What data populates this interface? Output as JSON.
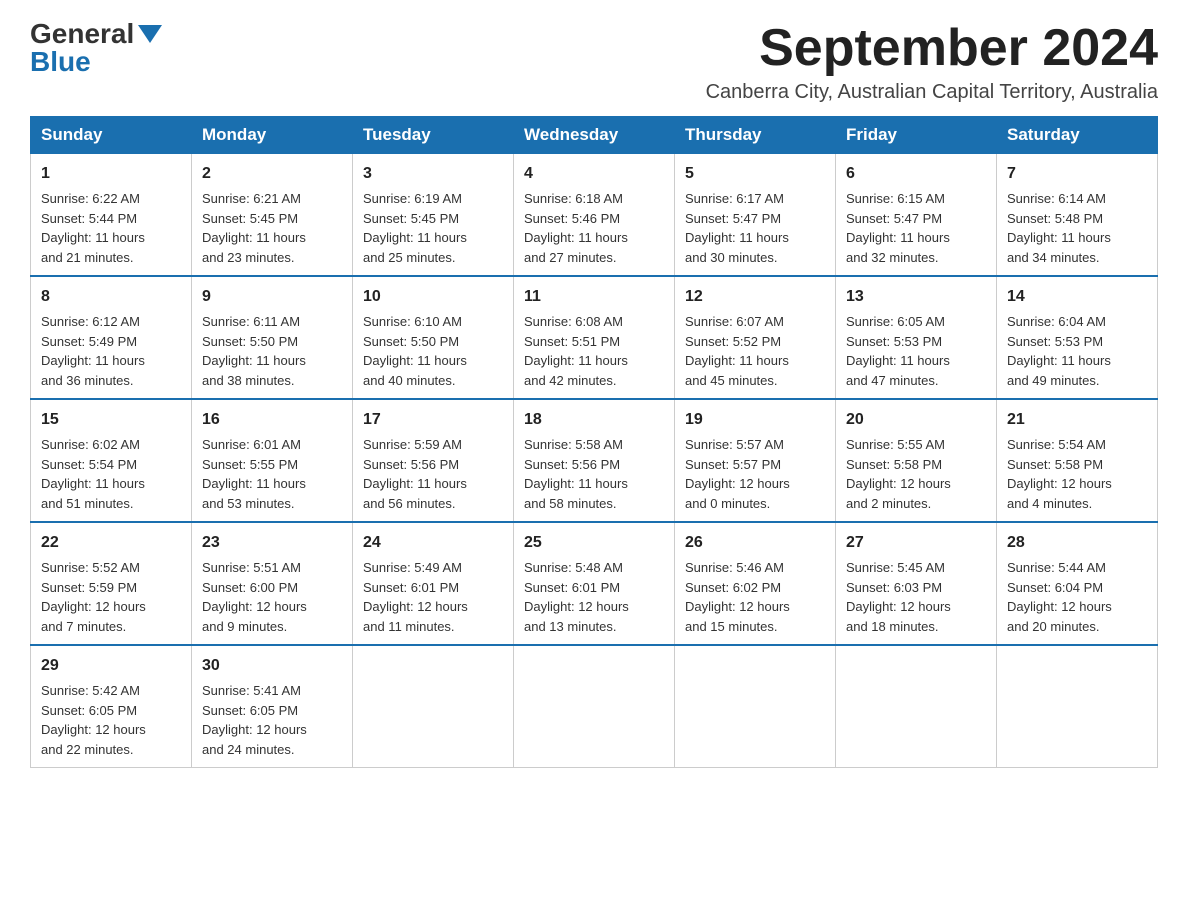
{
  "logo": {
    "general": "General",
    "blue": "Blue"
  },
  "title": "September 2024",
  "subtitle": "Canberra City, Australian Capital Territory, Australia",
  "days_of_week": [
    "Sunday",
    "Monday",
    "Tuesday",
    "Wednesday",
    "Thursday",
    "Friday",
    "Saturday"
  ],
  "weeks": [
    [
      {
        "day": "1",
        "sunrise": "6:22 AM",
        "sunset": "5:44 PM",
        "daylight": "11 hours and 21 minutes."
      },
      {
        "day": "2",
        "sunrise": "6:21 AM",
        "sunset": "5:45 PM",
        "daylight": "11 hours and 23 minutes."
      },
      {
        "day": "3",
        "sunrise": "6:19 AM",
        "sunset": "5:45 PM",
        "daylight": "11 hours and 25 minutes."
      },
      {
        "day": "4",
        "sunrise": "6:18 AM",
        "sunset": "5:46 PM",
        "daylight": "11 hours and 27 minutes."
      },
      {
        "day": "5",
        "sunrise": "6:17 AM",
        "sunset": "5:47 PM",
        "daylight": "11 hours and 30 minutes."
      },
      {
        "day": "6",
        "sunrise": "6:15 AM",
        "sunset": "5:47 PM",
        "daylight": "11 hours and 32 minutes."
      },
      {
        "day": "7",
        "sunrise": "6:14 AM",
        "sunset": "5:48 PM",
        "daylight": "11 hours and 34 minutes."
      }
    ],
    [
      {
        "day": "8",
        "sunrise": "6:12 AM",
        "sunset": "5:49 PM",
        "daylight": "11 hours and 36 minutes."
      },
      {
        "day": "9",
        "sunrise": "6:11 AM",
        "sunset": "5:50 PM",
        "daylight": "11 hours and 38 minutes."
      },
      {
        "day": "10",
        "sunrise": "6:10 AM",
        "sunset": "5:50 PM",
        "daylight": "11 hours and 40 minutes."
      },
      {
        "day": "11",
        "sunrise": "6:08 AM",
        "sunset": "5:51 PM",
        "daylight": "11 hours and 42 minutes."
      },
      {
        "day": "12",
        "sunrise": "6:07 AM",
        "sunset": "5:52 PM",
        "daylight": "11 hours and 45 minutes."
      },
      {
        "day": "13",
        "sunrise": "6:05 AM",
        "sunset": "5:53 PM",
        "daylight": "11 hours and 47 minutes."
      },
      {
        "day": "14",
        "sunrise": "6:04 AM",
        "sunset": "5:53 PM",
        "daylight": "11 hours and 49 minutes."
      }
    ],
    [
      {
        "day": "15",
        "sunrise": "6:02 AM",
        "sunset": "5:54 PM",
        "daylight": "11 hours and 51 minutes."
      },
      {
        "day": "16",
        "sunrise": "6:01 AM",
        "sunset": "5:55 PM",
        "daylight": "11 hours and 53 minutes."
      },
      {
        "day": "17",
        "sunrise": "5:59 AM",
        "sunset": "5:56 PM",
        "daylight": "11 hours and 56 minutes."
      },
      {
        "day": "18",
        "sunrise": "5:58 AM",
        "sunset": "5:56 PM",
        "daylight": "11 hours and 58 minutes."
      },
      {
        "day": "19",
        "sunrise": "5:57 AM",
        "sunset": "5:57 PM",
        "daylight": "12 hours and 0 minutes."
      },
      {
        "day": "20",
        "sunrise": "5:55 AM",
        "sunset": "5:58 PM",
        "daylight": "12 hours and 2 minutes."
      },
      {
        "day": "21",
        "sunrise": "5:54 AM",
        "sunset": "5:58 PM",
        "daylight": "12 hours and 4 minutes."
      }
    ],
    [
      {
        "day": "22",
        "sunrise": "5:52 AM",
        "sunset": "5:59 PM",
        "daylight": "12 hours and 7 minutes."
      },
      {
        "day": "23",
        "sunrise": "5:51 AM",
        "sunset": "6:00 PM",
        "daylight": "12 hours and 9 minutes."
      },
      {
        "day": "24",
        "sunrise": "5:49 AM",
        "sunset": "6:01 PM",
        "daylight": "12 hours and 11 minutes."
      },
      {
        "day": "25",
        "sunrise": "5:48 AM",
        "sunset": "6:01 PM",
        "daylight": "12 hours and 13 minutes."
      },
      {
        "day": "26",
        "sunrise": "5:46 AM",
        "sunset": "6:02 PM",
        "daylight": "12 hours and 15 minutes."
      },
      {
        "day": "27",
        "sunrise": "5:45 AM",
        "sunset": "6:03 PM",
        "daylight": "12 hours and 18 minutes."
      },
      {
        "day": "28",
        "sunrise": "5:44 AM",
        "sunset": "6:04 PM",
        "daylight": "12 hours and 20 minutes."
      }
    ],
    [
      {
        "day": "29",
        "sunrise": "5:42 AM",
        "sunset": "6:05 PM",
        "daylight": "12 hours and 22 minutes."
      },
      {
        "day": "30",
        "sunrise": "5:41 AM",
        "sunset": "6:05 PM",
        "daylight": "12 hours and 24 minutes."
      },
      null,
      null,
      null,
      null,
      null
    ]
  ],
  "labels": {
    "sunrise": "Sunrise:",
    "sunset": "Sunset:",
    "daylight": "Daylight:"
  }
}
